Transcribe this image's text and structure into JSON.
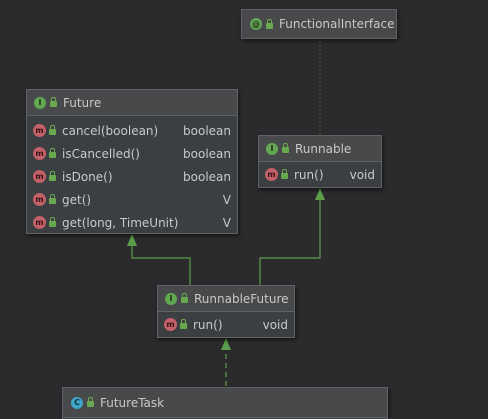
{
  "classes": {
    "functional_interface": {
      "badge": "@",
      "name": "FunctionalInterface"
    },
    "future": {
      "badge": "I",
      "name": "Future",
      "methods": [
        {
          "badge": "m",
          "name": "cancel(boolean)",
          "type": "boolean"
        },
        {
          "badge": "m",
          "name": "isCancelled()",
          "type": "boolean"
        },
        {
          "badge": "m",
          "name": "isDone()",
          "type": "boolean"
        },
        {
          "badge": "m",
          "name": "get()",
          "type": "V"
        },
        {
          "badge": "m",
          "name": "get(long, TimeUnit)",
          "type": "V"
        }
      ]
    },
    "runnable": {
      "badge": "I",
      "name": "Runnable",
      "methods": [
        {
          "badge": "m",
          "name": "run()",
          "type": "void"
        }
      ]
    },
    "runnable_future": {
      "badge": "I",
      "name": "RunnableFuture",
      "methods": [
        {
          "badge": "m",
          "name": "run()",
          "type": "void"
        }
      ]
    },
    "future_task": {
      "badge": "C",
      "name": "FutureTask"
    }
  },
  "colors": {
    "background": "#2b2b2d",
    "box_fill": "#3c3f41",
    "header_fill": "#47494b",
    "edge_green": "#5a9e4b",
    "annotation_edge": "#6e7a58",
    "interface_badge": "#62a854",
    "class_badge": "#3fa6c9",
    "method_badge": "#c4606a"
  },
  "icons": {
    "interface": "interface-icon",
    "class": "class-icon",
    "annotation": "annotation-icon",
    "method": "method-icon",
    "visibility": "lock-icon"
  }
}
